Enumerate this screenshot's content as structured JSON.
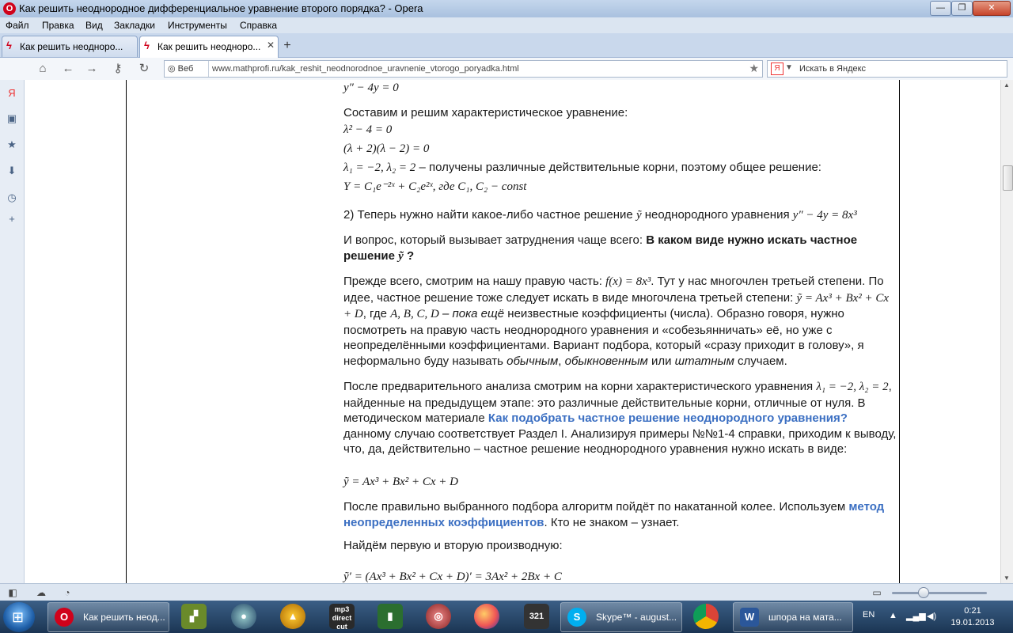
{
  "window": {
    "title": "Как решить неоднородное дифференциальное уравнение второго порядка? - Opera",
    "logo_letter": "O",
    "minimize": "—",
    "maximize": "❐",
    "close": "✕"
  },
  "menu": [
    "Файл",
    "Правка",
    "Вид",
    "Закладки",
    "Инструменты",
    "Справка"
  ],
  "tabs": [
    {
      "label": "Как решить неодноро..."
    },
    {
      "label": "Как решить неодноро..."
    }
  ],
  "address": {
    "web_label": "Веб",
    "url": "www.mathprofi.ru/kak_reshit_neodnorodnoe_uravnenie_vtorogo_poryadka.html",
    "search_placeholder": "Искать в Яндекс",
    "search_engine_letter": "Я"
  },
  "content": {
    "eq_top": "y″ − 4y = 0",
    "p1": "Составим и решим характеристическое уравнение:",
    "eq1": "λ² − 4 = 0",
    "eq2": "(λ + 2)(λ − 2) = 0",
    "roots_math": "λ₁ = −2, λ₂ = 2",
    "roots_text": " – получены различные действительные корни, поэтому общее решение:",
    "eq_general": "Y = C₁e⁻²ˣ + C₂e²ˣ,  где C₁, C₂ − const",
    "p2_text": "2) Теперь нужно найти какое-либо частное решение ",
    "p2_math1": "ỹ",
    "p2_text2": " неоднородного уравнения ",
    "p2_math2": "y″ − 4y = 8x³",
    "p3_text": "И вопрос, который вызывает затруднения чаще всего: ",
    "p3_bold": "В каком виде нужно искать частное решение ",
    "p3_bold_math": "ỹ",
    "p3_bold_end": " ?",
    "p4_a": "Прежде всего, смотрим на нашу правую часть: ",
    "p4_math1": "f(x) = 8x³",
    "p4_b": ". Тут у нас многочлен третьей степени. По идее, частное решение тоже следует искать в виде многочлена третьей степени: ",
    "p4_math2": "ỹ = Ax³ + Bx² + Cx + D",
    "p4_c": ", где ",
    "p4_math3": "A, B, C, D",
    "p4_italic": " – пока ещё",
    "p4_d": " неизвестные коэффициенты (числа). Образно говоря, нужно посмотреть на правую часть неоднородного уравнения и «собезьянничать» её, но уже с неопределёнными коэффициентами. Вариант подбора, который «сразу приходит в голову», я неформально буду называть ",
    "p4_i1": "обычным",
    "p4_e": ", ",
    "p4_i2": "обыкновенным",
    "p4_f": " или ",
    "p4_i3": "штатным",
    "p4_g": " случаем.",
    "p5_a": "После предварительного анализа смотрим на корни характеристического уравнения ",
    "p5_math": "λ₁ = −2, λ₂ = 2",
    "p5_b": ", найденные на предыдущем этапе: это различные действительные корни, отличные от нуля. В методическом материале ",
    "p5_link": "Как подобрать частное решение неоднородного уравнения?",
    "p5_c": " данному случаю соответствует Раздел I. Анализируя примеры №№1-4 справки, приходим к выводу, что, да, действительно – частное решение неоднородного уравнения нужно искать в виде:",
    "eq_form": "ỹ = Ax³ + Bx² + Cx + D",
    "p6_a": "После правильно выбранного подбора алгоритм пойдёт по накатанной колее. Используем ",
    "p6_link": "метод неопределенных коэффициентов",
    "p6_b": ". Кто не знаком – узнает.",
    "p7": "Найдём первую и вторую производную:",
    "eq_deriv": "ỹ′ = (Ax³ + Bx² + Cx + D)′ = 3Ax² + 2Bx + C"
  },
  "taskbar": {
    "items": [
      {
        "label": "Как решить неод..."
      },
      {
        "label": "Skype™ - august..."
      },
      {
        "label": "шпора на мата..."
      }
    ],
    "pinned_labels": [
      "mp3 direct cut",
      "321"
    ],
    "lang": "EN",
    "time": "0:21",
    "date": "19.01.2013"
  },
  "icons": [
    "opera-icon",
    "yandex-icon",
    "home-icon",
    "back-icon",
    "forward-icon",
    "key-icon",
    "reload-icon",
    "bookmark-star-icon",
    "windows-start-icon",
    "firefox-icon",
    "chrome-icon",
    "word-icon",
    "skype-icon"
  ],
  "colors": {
    "link": "#3b6fc2",
    "titlebar": "#b7cae4",
    "taskbar": "#24456a"
  }
}
